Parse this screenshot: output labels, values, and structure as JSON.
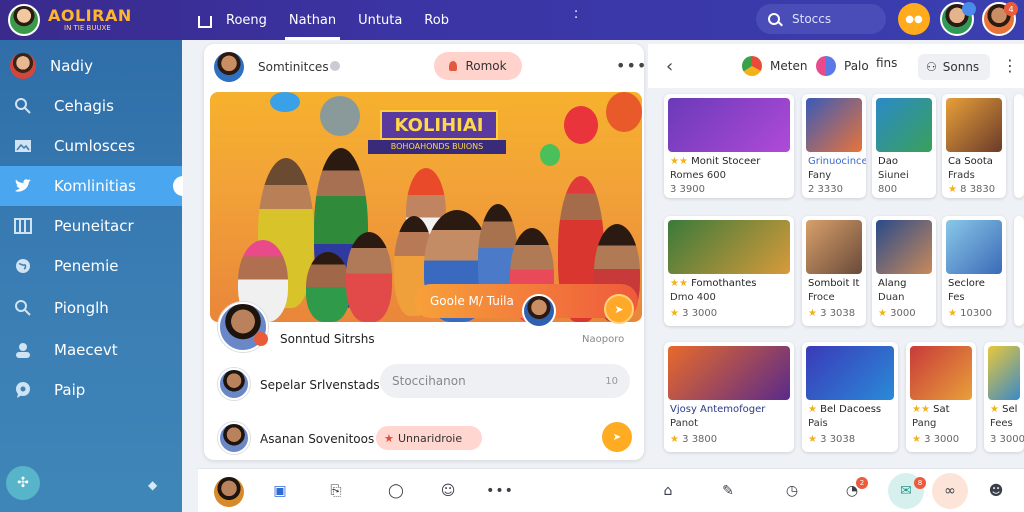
{
  "app": {
    "logo_text": "AOLIRAN",
    "logo_sub": "IN TIE BUUXE"
  },
  "topnav": {
    "items": [
      "Roeng",
      "Nathan",
      "Untuta",
      "Rob"
    ]
  },
  "search": {
    "placeholder": "Stoccs"
  },
  "header_badges": {
    "orange": "",
    "avatar1": "",
    "avatar2": "4"
  },
  "sidebar": {
    "items": [
      {
        "label": "Nadiy",
        "icon": "avatar-icon"
      },
      {
        "label": "Cehagis",
        "icon": "search-icon"
      },
      {
        "label": "Cumlosces",
        "icon": "image-icon"
      },
      {
        "label": "Komlinitias",
        "icon": "twitter-bird-icon"
      },
      {
        "label": "Peuneitacr",
        "icon": "grid-icon"
      },
      {
        "label": "Penemie",
        "icon": "globe-icon"
      },
      {
        "label": "Pionglh",
        "icon": "search-icon"
      },
      {
        "label": "Maecevt",
        "icon": "user-icon"
      },
      {
        "label": "Paip",
        "icon": "chat-icon"
      }
    ]
  },
  "feed": {
    "header_title": "Somtinitces",
    "pill_label": "Romok",
    "hero": {
      "banner": "KOLIHIAI",
      "banner_sub": "BOHOAHONDS BUIONS",
      "cta": "Goole M/ Tuila"
    },
    "rows": [
      {
        "name": "Sonntud Sitrshs",
        "meta": "Naoporo"
      },
      {
        "name": "Sepelar Srlvenstads",
        "input_placeholder": "Stoccihanon",
        "count": "10"
      },
      {
        "name": "Asanan Sovenitoos",
        "tag": "Unnaridroie"
      }
    ]
  },
  "right_panel": {
    "chips": [
      {
        "label": "Meten",
        "color": "#e94a3a"
      },
      {
        "label": "Palo",
        "color": "#5a7ae8"
      }
    ],
    "chip_extra": "fins",
    "sort_label": "Sonns",
    "cards_row1": [
      {
        "l1": "Monit Stoceer",
        "l2": "Romes 600",
        "l3": "3 3900"
      },
      {
        "l1": "Grinuocince",
        "l2": "Fany",
        "l3": "2 3330"
      },
      {
        "l1": "Dao",
        "l2": "Siunei",
        "l3": "800"
      },
      {
        "l1": "Ca Soota",
        "l2": "Frads",
        "l3": "8 3830"
      }
    ],
    "cards_row2": [
      {
        "l1": "Fomothantes",
        "l2": "Dmo 400",
        "l3": "3 3000"
      },
      {
        "l1": "Somboit It",
        "l2": "Froce",
        "l3": "3 3038"
      },
      {
        "l1": "Alang",
        "l2": "Duan",
        "l3": "3000"
      },
      {
        "l1": "Seclore",
        "l2": "Fes",
        "l3": "10300"
      }
    ],
    "cards_row3": [
      {
        "l1": "Vjosy Antemofoger",
        "l2": "Panot",
        "l3": "3 3800"
      },
      {
        "l1": "Bel Dacoess",
        "l2": "Pais",
        "l3": "3 3038"
      },
      {
        "l1": "Sat",
        "l2": "Pang",
        "l3": "3 3000"
      },
      {
        "l1": "Sel",
        "l2": "Fees",
        "l3": "3 3000"
      }
    ]
  },
  "bottombar": {
    "badge1": "2",
    "badge2": "8"
  }
}
